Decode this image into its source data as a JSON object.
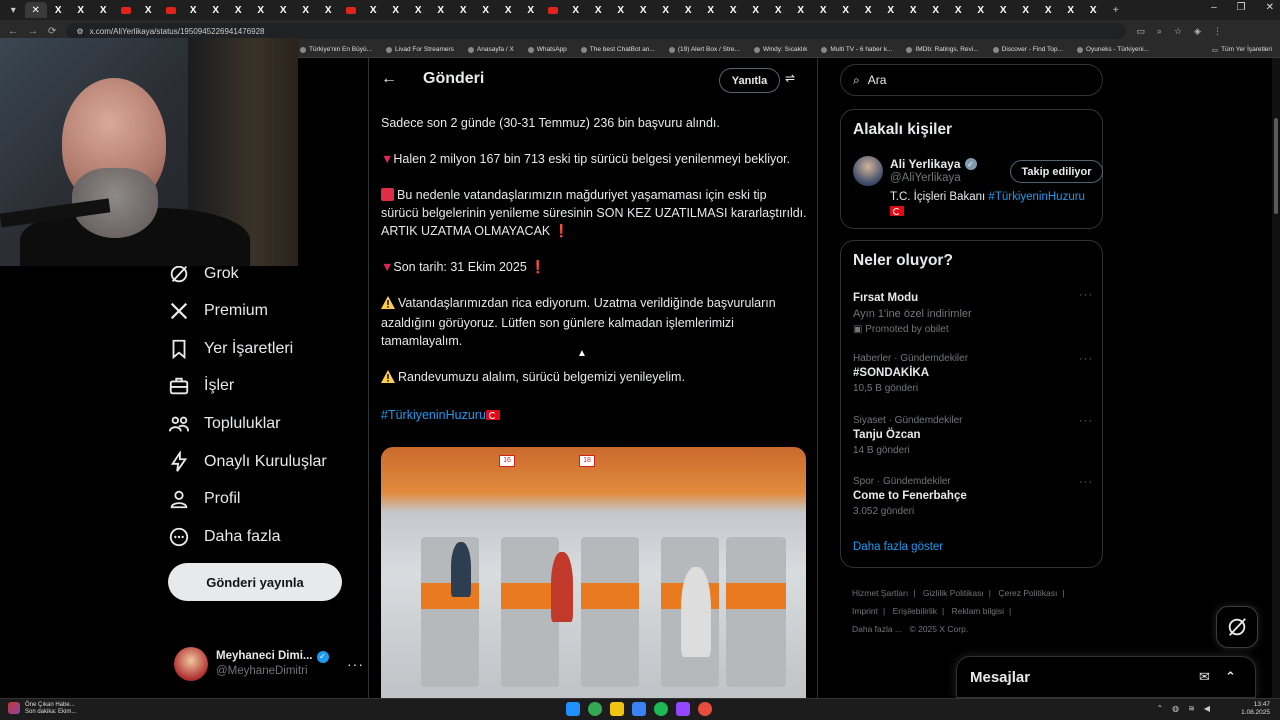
{
  "browser": {
    "url": "x.com/AliYerlikaya/status/1950945226941476928",
    "bookmarks": [
      "Türkiye'nin En Büyü...",
      "Livad For Streamers",
      "Anasayfa / X",
      "WhatsApp",
      "The best ChatBot an...",
      "(19) Alert Box / Stre...",
      "Windy: Sıcaklık",
      "Multi TV - 6 haber k...",
      "IMDb: Ratings, Revi...",
      "Discover - Find Top...",
      "Oyuneks - Türkiyeni..."
    ],
    "all_bookmarks": "Tüm Yer İşaretleri"
  },
  "sidebar": {
    "items": [
      {
        "label": "Grok",
        "icon": "grok-icon"
      },
      {
        "label": "Premium",
        "icon": "x-logo-icon"
      },
      {
        "label": "Yer İşaretleri",
        "icon": "bookmark-icon"
      },
      {
        "label": "İşler",
        "icon": "briefcase-icon"
      },
      {
        "label": "Topluluklar",
        "icon": "communities-icon"
      },
      {
        "label": "Onaylı Kuruluşlar",
        "icon": "lightning-icon"
      },
      {
        "label": "Profil",
        "icon": "profile-icon"
      },
      {
        "label": "Daha fazla",
        "icon": "more-circle-icon"
      }
    ],
    "post_button": "Gönderi yayınla",
    "account": {
      "name": "Meyhaneci Dimi...",
      "handle": "@MeyhaneDimitri"
    }
  },
  "main": {
    "title": "Gönderi",
    "reply_button": "Yanıtla",
    "tweet": {
      "p1": "Sadece son 2 günde (30-31 Temmuz) 236 bin başvuru alındı.",
      "p2": "Halen 2 milyon 167 bin 713 eski tip sürücü belgesi yenilenmeyi bekliyor.",
      "p3": "Bu nedenle vatandaşlarımızın mağduriyet yaşamaması için eski tip sürücü belgelerinin yenileme süresinin SON KEZ UZATILMASI kararlaştırıldı. ARTIK UZATMA OLMAYACAK",
      "p4": "Son tarih: 31 Ekim 2025",
      "p5": "Vatandaşlarımızdan rica ediyorum. Uzatma verildiğinde başvuruların azaldığını görüyoruz. Lütfen son günlere kalmadan işlemlerimizi tamamlayalım.",
      "p6": "Randevumuzu alalım, sürücü belgemizi yenileyelim.",
      "hashtag": "#TürkiyeninHuzuru"
    }
  },
  "right": {
    "search_placeholder": "Ara",
    "relevant": {
      "title": "Alakalı kişiler",
      "name": "Ali Yerlikaya",
      "handle": "@AliYerlikaya",
      "bio_text": "T.C. İçişleri Bakanı ",
      "bio_tag": "#TürkiyeninHuzuru",
      "follow_button": "Takip ediliyor"
    },
    "trends": {
      "title": "Neler oluyor?",
      "promo": {
        "title": "Fırsat Modu",
        "subtitle": "Ayın 1'ine özel indirimler",
        "promoted": "Promoted by obilet"
      },
      "items": [
        {
          "meta": "Haberler · Gündemdekiler",
          "title": "#SONDAKİKA",
          "count": "10,5 B gönderi"
        },
        {
          "meta": "Siyaset · Gündemdekiler",
          "title": "Tanju Özcan",
          "count": "14 B gönderi"
        },
        {
          "meta": "Spor · Gündemdekiler",
          "title": "Come to Fenerbahçe",
          "count": "3.052 gönderi"
        }
      ],
      "show_more": "Daha fazla göster"
    },
    "footer": {
      "links": [
        "Hizmet Şartları",
        "Gizlilik Politikası",
        "Çerez Politikası",
        "Imprint",
        "Erişilebilirlik",
        "Reklam bilgisi",
        "Daha fazla ..."
      ],
      "copyright": "© 2025 X Corp."
    }
  },
  "messages": {
    "title": "Mesajlar"
  },
  "taskbar": {
    "news_title": "Öne Çıkan Habe...",
    "news_sub": "Son dakika: Ekim...",
    "time": "13:47",
    "date": "1.08.2025"
  },
  "colors": {
    "accent": "#1d9bf0",
    "background": "#000000",
    "text": "#e7e9ea",
    "muted": "#71767b",
    "border": "#2f3336"
  }
}
